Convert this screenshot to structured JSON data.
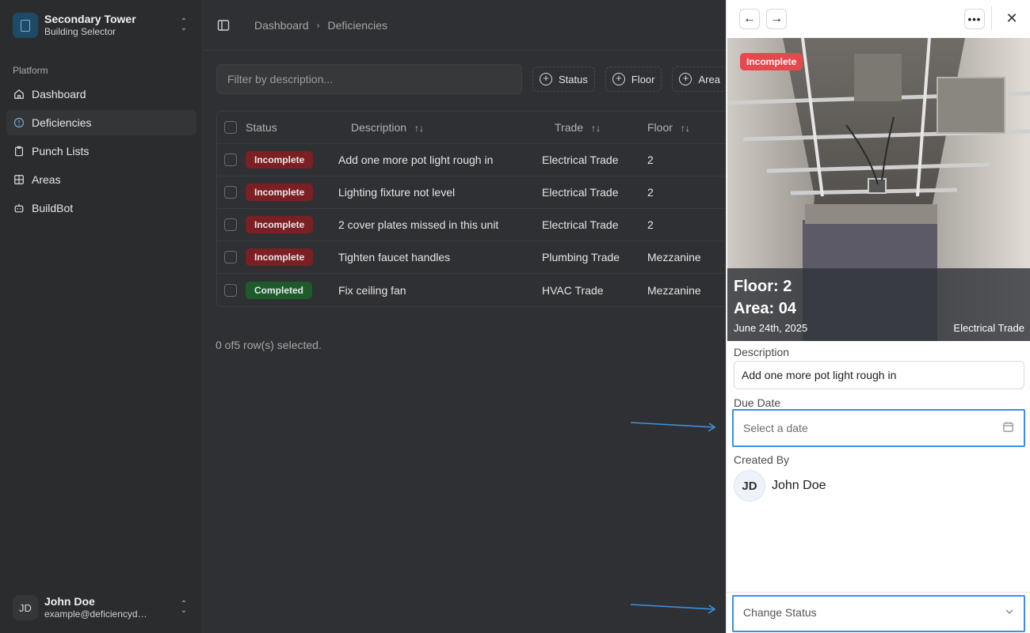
{
  "sidebar": {
    "building_title": "Secondary Tower",
    "building_subtitle": "Building Selector",
    "section_label": "Platform",
    "items": [
      {
        "label": "Dashboard"
      },
      {
        "label": "Deficiencies"
      },
      {
        "label": "Punch Lists"
      },
      {
        "label": "Areas"
      },
      {
        "label": "BuildBot"
      }
    ],
    "user": {
      "initials": "JD",
      "name": "John Doe",
      "email": "example@deficiencydetect...."
    }
  },
  "breadcrumb": {
    "root": "Dashboard",
    "current": "Deficiencies"
  },
  "toolbar": {
    "filter_placeholder": "Filter by description...",
    "filters": [
      "Status",
      "Floor",
      "Area"
    ]
  },
  "table": {
    "headers": {
      "status": "Status",
      "description": "Description",
      "trade": "Trade",
      "floor": "Floor"
    },
    "rows": [
      {
        "status": "Incomplete",
        "description": "Add one more pot light rough in",
        "trade": "Electrical Trade",
        "floor": "2"
      },
      {
        "status": "Incomplete",
        "description": "Lighting fixture not level",
        "trade": "Electrical Trade",
        "floor": "2"
      },
      {
        "status": "Incomplete",
        "description": "2 cover plates missed in this unit",
        "trade": "Electrical Trade",
        "floor": "2"
      },
      {
        "status": "Incomplete",
        "description": "Tighten faucet handles",
        "trade": "Plumbing Trade",
        "floor": "Mezzanine"
      },
      {
        "status": "Completed",
        "description": "Fix ceiling fan",
        "trade": "HVAC Trade",
        "floor": "Mezzanine"
      }
    ],
    "selection_info": "0 of5 row(s) selected."
  },
  "colors": {
    "incomplete": "#7a1f23",
    "completed": "#1d5a2c",
    "highlight": "#3d8fe0",
    "panel_badge": "#e5484d"
  },
  "panel": {
    "status_badge": "Incomplete",
    "floor": "Floor: 2",
    "area": "Area: 04",
    "date": "June 24th, 2025",
    "trade": "Electrical Trade",
    "description_label": "Description",
    "description_value": "Add one more pot light rough in",
    "due_date_label": "Due Date",
    "due_date_placeholder": "Select a date",
    "created_by_label": "Created By",
    "creator_initials": "JD",
    "creator_name": "John Doe",
    "status_select": "Change Status"
  }
}
